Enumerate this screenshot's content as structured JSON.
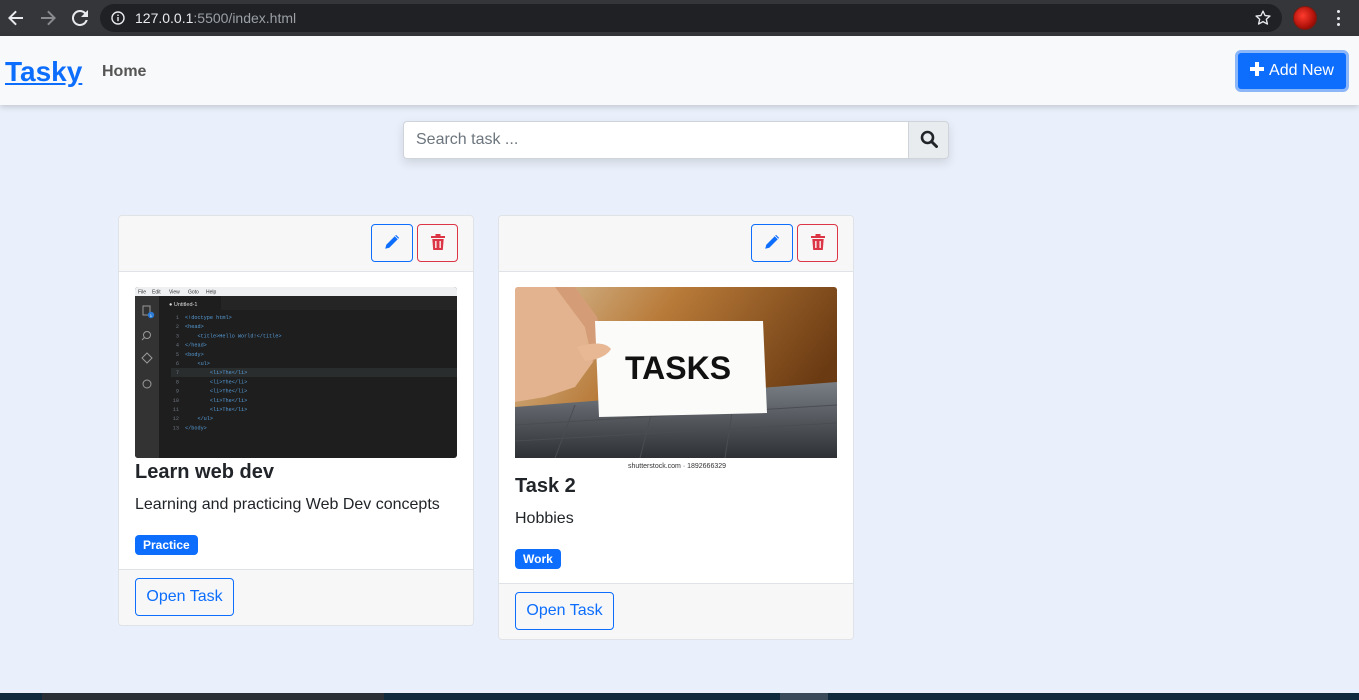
{
  "browser": {
    "url_host": "127.0.0.1",
    "url_rest": ":5500/index.html",
    "icons": [
      "back-arrow-icon",
      "forward-arrow-icon",
      "reload-icon",
      "info-icon",
      "star-icon",
      "profile-avatar",
      "kebab-menu-icon"
    ]
  },
  "navbar": {
    "brand": "Tasky",
    "home_label": "Home",
    "add_new_label": "Add New",
    "add_icon": "plus-icon"
  },
  "search": {
    "placeholder": "Search task ...",
    "value": "",
    "icon": "search-icon"
  },
  "cards": [
    {
      "title": "Learn web dev",
      "description": "Learning and practicing Web Dev concepts",
      "tag": "Practice",
      "open_label": "Open Task",
      "image": {
        "menu": [
          "File",
          "Edit",
          "View",
          "Goto",
          "Help"
        ],
        "tab": "● Untitled-1",
        "badge": "1",
        "lines": [
          {
            "n": "1",
            "t": "<!doctype html>"
          },
          {
            "n": "2",
            "t": "<head>"
          },
          {
            "n": "3",
            "t": "    <title>Hello World!</title>"
          },
          {
            "n": "4",
            "t": "</head>"
          },
          {
            "n": "5",
            "t": "<body>"
          },
          {
            "n": "6",
            "t": "    <ul>"
          },
          {
            "n": "7",
            "t": "        <li>The</li>"
          },
          {
            "n": "8",
            "t": "        <li>The</li>"
          },
          {
            "n": "9",
            "t": "        <li>The</li>"
          },
          {
            "n": "10",
            "t": "        <li>The</li>"
          },
          {
            "n": "11",
            "t": "        <li>The</li>"
          },
          {
            "n": "12",
            "t": "    </ul>"
          },
          {
            "n": "13",
            "t": "</body>"
          }
        ]
      }
    },
    {
      "title": "Task 2",
      "description": "Hobbies",
      "tag": "Work",
      "open_label": "Open Task",
      "image": {
        "card_word": "TASKS",
        "caption": "shutterstock.com · 1892666329"
      }
    }
  ],
  "colors": {
    "primary": "#0d6efd",
    "danger": "#dc3545",
    "page_bg": "#eaf0fb",
    "navbar_bg": "#f8f9fa"
  }
}
